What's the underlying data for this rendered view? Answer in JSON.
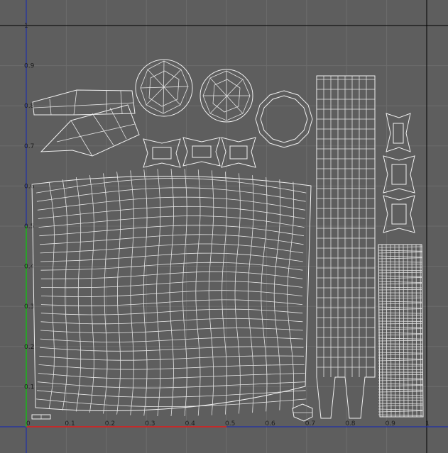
{
  "editor": {
    "background_color": "#5e5e5e",
    "grid_color": "#6c6c6c",
    "border_color": "#000000",
    "u_axis_color": "#c22a2a",
    "v_axis_color": "#2aa12a",
    "v_axis_secondary_color": "#1f2fa8",
    "wire_color": "#f0f0f0",
    "u_ticks": [
      "0",
      "0.1",
      "0.2",
      "0.3",
      "0.4",
      "0.5",
      "0.6",
      "0.7",
      "0.8",
      "0.9",
      "1"
    ],
    "v_ticks": [
      "0.1",
      "0.2",
      "0.3",
      "0.4",
      "0.5",
      "0.6",
      "0.7",
      "0.8",
      "0.9",
      "1"
    ]
  }
}
